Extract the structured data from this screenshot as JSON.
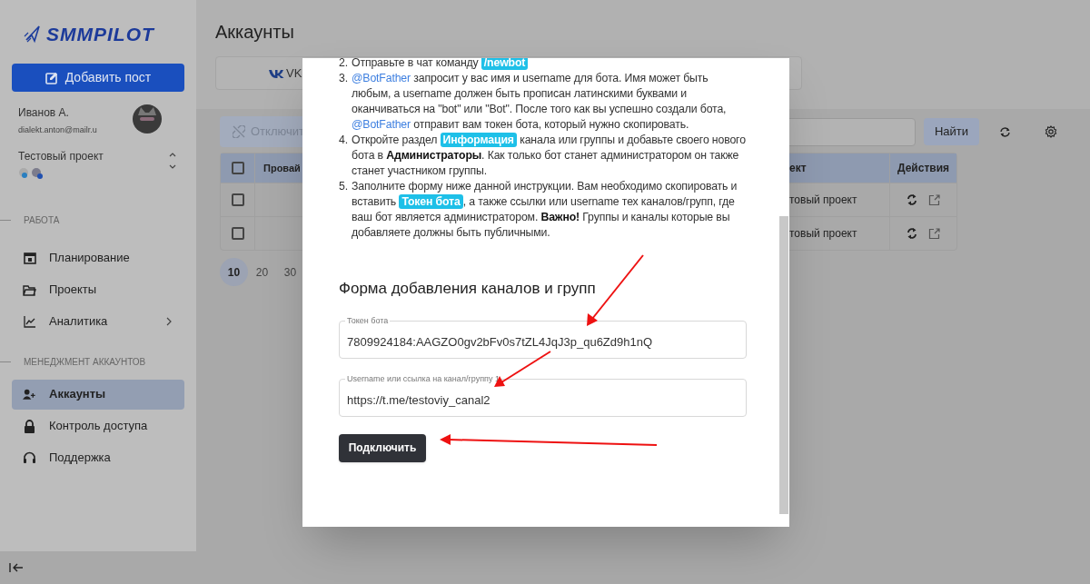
{
  "sidebar": {
    "logo": "SMMPILOT",
    "add_post_button": "Добавить пост",
    "user": {
      "name": "Иванов А.",
      "email": "dialekt.anton@mailr.u"
    },
    "project": {
      "name": "Тестовый проект"
    },
    "sections": [
      {
        "title": "РАБОТА",
        "items": [
          {
            "label": "Планирование",
            "selected": false,
            "expandable": false
          },
          {
            "label": "Проекты",
            "selected": false,
            "expandable": false
          },
          {
            "label": "Аналитика",
            "selected": false,
            "expandable": true
          }
        ]
      },
      {
        "title": "МЕНЕДЖМЕНТ АККАУНТОВ",
        "items": [
          {
            "label": "Аккаунты",
            "selected": true,
            "expandable": false
          },
          {
            "label": "Контроль доступа",
            "selected": false,
            "expandable": false
          },
          {
            "label": "Поддержка",
            "selected": false,
            "expandable": false
          }
        ]
      }
    ]
  },
  "main": {
    "title": "Аккаунты",
    "tabs": [
      {
        "label": "VK",
        "selected": false
      }
    ],
    "toolbar": {
      "disconnect_button": "Отключит",
      "disconnect_disabled": true,
      "search_button": "Найти"
    },
    "table": {
      "header_checked": false,
      "columns": [
        "Провай",
        "ект",
        "Действия"
      ],
      "rows": [
        {
          "checked": false,
          "project": "товый проект"
        },
        {
          "checked": false,
          "project": "товый проект"
        }
      ]
    },
    "pagination": [
      {
        "label": "10",
        "selected": true
      },
      {
        "label": "20",
        "selected": false
      },
      {
        "label": "30",
        "selected": false
      }
    ]
  },
  "modal": {
    "steps": [
      {
        "number": "2.",
        "segments": [
          {
            "kind": "text",
            "text": "Отправьте в чат команду "
          },
          {
            "kind": "chip",
            "text": "/newbot"
          }
        ]
      },
      {
        "number": "3.",
        "segments": [
          {
            "kind": "link",
            "text": "@BotFather"
          },
          {
            "kind": "text",
            "text": " запросит у вас имя и username для бота. Имя может быть любым, а username должен быть прописан латинскими буквами и оканчиваться на \"bot\" или \"Bot\". После того как вы успешно создали бота, "
          },
          {
            "kind": "link",
            "text": "@BotFather"
          },
          {
            "kind": "text",
            "text": " отправит вам токен бота, который нужно скопировать."
          }
        ]
      },
      {
        "number": "4.",
        "segments": [
          {
            "kind": "text",
            "text": "Откройте раздел "
          },
          {
            "kind": "chip",
            "text": "Информация"
          },
          {
            "kind": "text",
            "text": " канала или группы и добавьте своего нового бота в "
          },
          {
            "kind": "bold",
            "text": "Администраторы"
          },
          {
            "kind": "text",
            "text": ". Как только бот станет администратором он также станет участником группы."
          }
        ]
      },
      {
        "number": "5.",
        "segments": [
          {
            "kind": "text",
            "text": "Заполните форму ниже данной инструкции. Вам необходимо скопировать и вставить "
          },
          {
            "kind": "chip",
            "text": "Токен бота"
          },
          {
            "kind": "text",
            "text": ", а также ссылки или username тех каналов/групп, где ваш бот является администратором. "
          },
          {
            "kind": "bold",
            "text": "Важно!"
          },
          {
            "kind": "text",
            "text": " Группы и каналы которые вы добавляете должны быть публичными."
          }
        ]
      }
    ],
    "form_title": "Форма добавления каналов и групп",
    "fields": [
      {
        "label": "Токен бота",
        "value": "7809924184:AAGZO0gv2bFv0s7tZL4JqJ3p_qu6Zd9h1nQ"
      },
      {
        "label": "Username или ссылка на канал/группу 1",
        "value": "https://t.me/testoviy_canal2"
      }
    ],
    "submit_button": "Подключить"
  }
}
